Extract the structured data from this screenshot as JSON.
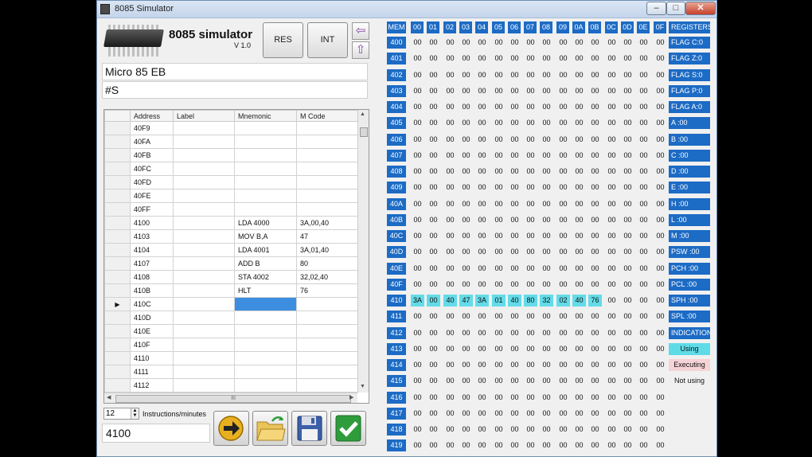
{
  "window": {
    "title": "8085 Simulator",
    "min": "–",
    "max": "□",
    "close": "✕"
  },
  "header": {
    "app_name": "8085 simulator",
    "version": "V 1.0",
    "res_label": "RES",
    "int_label": "INT",
    "left_arrow": "⇦",
    "up_arrow": "⇧"
  },
  "inputs": {
    "model": "Micro 85 EB",
    "command": "#S"
  },
  "editor": {
    "columns": [
      "Address",
      "Label",
      "Mnemonic",
      "M Code"
    ],
    "rows": [
      {
        "address": "40F9",
        "label": "",
        "mnemonic": "",
        "mcode": ""
      },
      {
        "address": "40FA",
        "label": "",
        "mnemonic": "",
        "mcode": ""
      },
      {
        "address": "40FB",
        "label": "",
        "mnemonic": "",
        "mcode": ""
      },
      {
        "address": "40FC",
        "label": "",
        "mnemonic": "",
        "mcode": ""
      },
      {
        "address": "40FD",
        "label": "",
        "mnemonic": "",
        "mcode": ""
      },
      {
        "address": "40FE",
        "label": "",
        "mnemonic": "",
        "mcode": ""
      },
      {
        "address": "40FF",
        "label": "",
        "mnemonic": "",
        "mcode": ""
      },
      {
        "address": "4100",
        "label": "",
        "mnemonic": "LDA 4000",
        "mcode": "3A,00,40"
      },
      {
        "address": "4103",
        "label": "",
        "mnemonic": "MOV B,A",
        "mcode": "47"
      },
      {
        "address": "4104",
        "label": "",
        "mnemonic": "LDA 4001",
        "mcode": "3A,01,40"
      },
      {
        "address": "4107",
        "label": "",
        "mnemonic": "ADD B",
        "mcode": "80"
      },
      {
        "address": "4108",
        "label": "",
        "mnemonic": "STA 4002",
        "mcode": "32,02,40"
      },
      {
        "address": "410B",
        "label": "",
        "mnemonic": "HLT",
        "mcode": "76"
      },
      {
        "address": "410C",
        "label": "",
        "mnemonic": "",
        "mcode": "",
        "current": true
      },
      {
        "address": "410D",
        "label": "",
        "mnemonic": "",
        "mcode": ""
      },
      {
        "address": "410E",
        "label": "",
        "mnemonic": "",
        "mcode": ""
      },
      {
        "address": "410F",
        "label": "",
        "mnemonic": "",
        "mcode": ""
      },
      {
        "address": "4110",
        "label": "",
        "mnemonic": "",
        "mcode": ""
      },
      {
        "address": "4111",
        "label": "",
        "mnemonic": "",
        "mcode": ""
      },
      {
        "address": "4112",
        "label": "",
        "mnemonic": "",
        "mcode": ""
      }
    ],
    "current_row_marker": "▶",
    "hscroll_grip": "III"
  },
  "controls": {
    "speed_value": "12",
    "speed_label": "Instructions/minutes",
    "pc_display": "4100"
  },
  "memory": {
    "corner": "MEM",
    "columns": [
      "00",
      "01",
      "02",
      "03",
      "04",
      "05",
      "06",
      "07",
      "08",
      "09",
      "0A",
      "0B",
      "0C",
      "0D",
      "0E",
      "0F"
    ],
    "rows": [
      "400",
      "401",
      "402",
      "403",
      "404",
      "405",
      "406",
      "407",
      "408",
      "409",
      "40A",
      "40B",
      "40C",
      "40D",
      "40E",
      "40F",
      "410",
      "411",
      "412",
      "413",
      "414",
      "415",
      "416",
      "417",
      "418",
      "419"
    ],
    "default_value": "00",
    "highlight_row": "410",
    "highlight_values": [
      "3A",
      "00",
      "40",
      "47",
      "3A",
      "01",
      "40",
      "80",
      "32",
      "02",
      "40",
      "76",
      "00",
      "00",
      "00",
      "00"
    ],
    "highlight_count": 12
  },
  "registers": {
    "title": "REGISTERS",
    "items": [
      "FLAG C:0",
      "FLAG Z:0",
      "FLAG S:0",
      "FLAG P:0",
      "FLAG A:0",
      "A :00",
      "B :00",
      "C :00",
      "D :00",
      "E :00",
      "H :00",
      "L :00",
      "M :00",
      "PSW :00",
      "PCH :00",
      "PCL :00",
      "SPH :00",
      "SPL :00"
    ]
  },
  "indication": {
    "title": "INDICATION",
    "using": "Using",
    "executing": "Executing",
    "not_using": "Not using"
  },
  "colors": {
    "accent": "#1c6bc5",
    "highlight": "#63dbe8",
    "executing": "#f6d3d6",
    "selection": "#3d8ee0"
  }
}
